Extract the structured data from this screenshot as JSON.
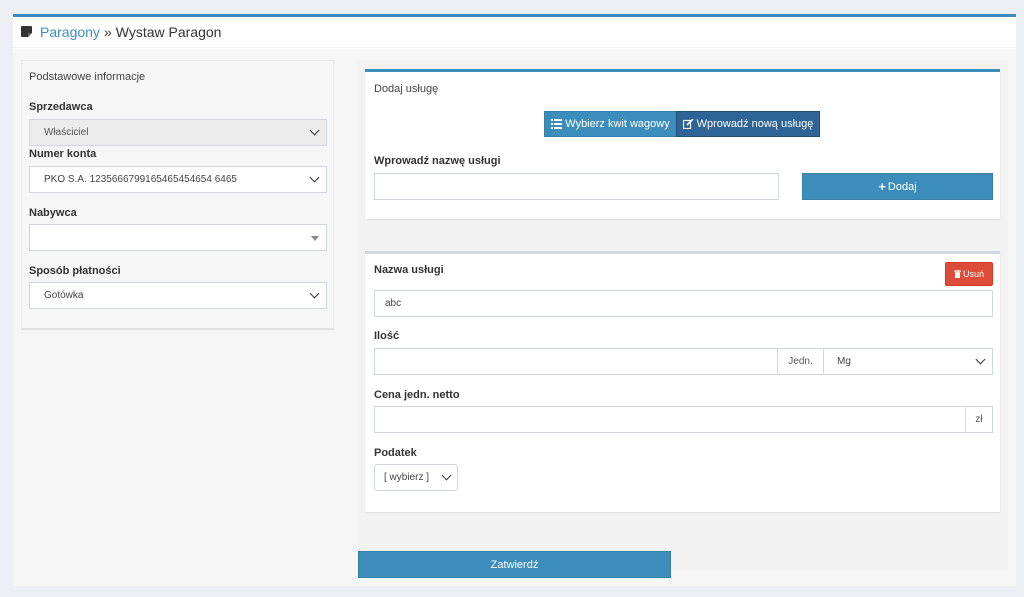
{
  "breadcrumb": {
    "link": "Paragony",
    "separator": "»",
    "current": "Wystaw Paragon"
  },
  "left": {
    "title": "Podstawowe informacje",
    "seller_label": "Sprzedawca",
    "seller_value": "Właściciel",
    "account_label": "Numer konta",
    "account_value": "PKO S.A. 1235666799165465454654 6465",
    "buyer_label": "Nabywca",
    "buyer_value": "",
    "payment_label": "Sposób płatności",
    "payment_value": "Gotówka"
  },
  "add_service": {
    "title": "Dodaj usługę",
    "tab_weight": "Wybierz kwit wagowy",
    "tab_new": "Wprowadź nową usługę",
    "name_label": "Wprowadź nazwę usługi",
    "name_value": "",
    "add_button": "Dodaj"
  },
  "service": {
    "name_label": "Nazwa usługi",
    "remove_button": "Usuń",
    "name_value": "abc",
    "qty_label": "Ilość",
    "qty_value": "",
    "unit_label": "Jedn.",
    "unit_value": "Mg",
    "price_label": "Cena jedn. netto",
    "price_value": "",
    "currency": "zł",
    "tax_label": "Podatek",
    "tax_value": "[ wybierz ]"
  },
  "submit_button": "Zatwierdź",
  "colors": {
    "primary": "#3c8dbc",
    "primary_dark": "#367fa9",
    "danger": "#dd4b39",
    "tab_active": "#2e6496"
  }
}
